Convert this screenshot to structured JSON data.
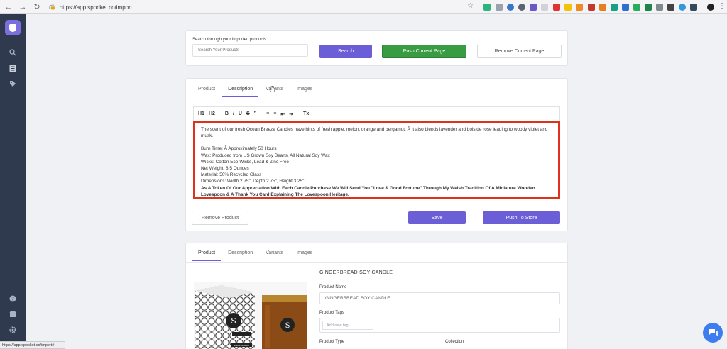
{
  "browser": {
    "url": "https://app.spocket.co/import",
    "status_url": "https://app.spocket.co/import#"
  },
  "search": {
    "label": "Search through your imported products",
    "placeholder": "Search Your Products",
    "search_button": "Search",
    "push_button": "Push Current Page",
    "remove_button": "Remove Current Page"
  },
  "editor_card": {
    "tabs": [
      "Product",
      "Description",
      "Variants",
      "Images"
    ],
    "active_tab": "Description",
    "toolbar": [
      "H1",
      "H2",
      "B",
      "I",
      "U",
      "S",
      "”",
      "≡",
      "≡",
      "⇤",
      "⇥",
      "Tx"
    ],
    "description": {
      "intro": "The scent of our fresh Ocean Breeze Candles have hints of fresh apple, melon, orange and bergamot. Â It also blends lavender and bois de rose leading to woody violet and musk.",
      "lines": [
        "Burn Time: Â Approximately 50 Hours",
        "Wax: Produced from US Grown Soy Beans. All Natural Soy Wax",
        "Wicks: Cotton Eco-Wicks, Lead & Zinc Free",
        "Net Weight: 8.5 Ounces",
        "Material: 50% Recycled Glass",
        "Dimensions: Width 2.75\", Depth 2.75\", Height 3.25\""
      ],
      "bold_text": "As A Token Of Our Appreciation With Each Candle Purchase We Will Send You \"Love & Good Fortune\" Through My Welsh Tradition Of A Miniature Wooden Lovespoon & A Thank You Card Explaining The Lovespoon Heritage."
    },
    "remove_button": "Remove Product",
    "save_button": "Save",
    "push_button": "Push To Store"
  },
  "product_card": {
    "tabs": [
      "Product",
      "Description",
      "Variants",
      "Images"
    ],
    "active_tab": "Product",
    "title": "GINGERBREAD SOY CANDLE",
    "product_name_label": "Product Name",
    "product_name_value": "GINGERBREAD SOY CANDLE",
    "product_tags_label": "Product Tags",
    "tag_placeholder": "Add new tag",
    "product_type_label": "Product Type",
    "collection_label": "Collection",
    "image_box_text": "GINGERBREAD"
  },
  "colors": {
    "accent": "#6c5ed6",
    "green": "#3a9c42",
    "highlight": "#e0301e",
    "sidebar": "#2f3a4f"
  }
}
